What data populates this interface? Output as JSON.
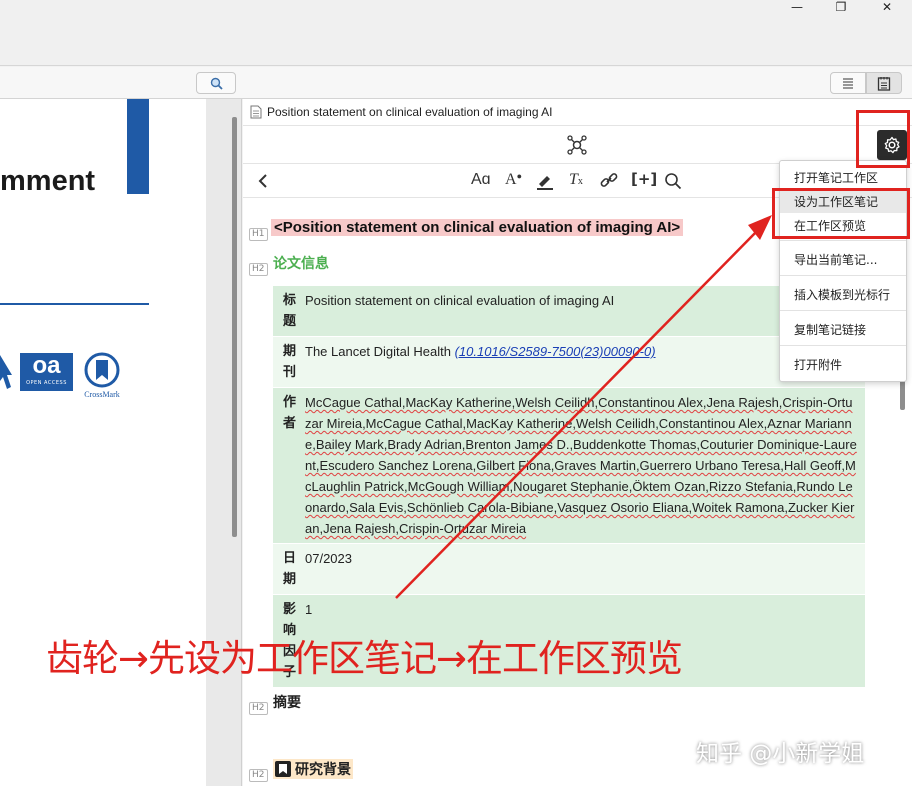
{
  "window": {
    "minimize": "—",
    "maximize": "❐",
    "close": "✕"
  },
  "pdf": {
    "heading_fragment": "mment",
    "oa_label": "oa",
    "oa_sub": "OPEN ACCESS",
    "crossmark_label": "CrossMark"
  },
  "note": {
    "doc_title": "Position statement on clinical evaluation of imaging AI",
    "h1_badge": "H1",
    "h1_text": "<Position statement on clinical evaluation of imaging AI>",
    "h2_badge": "H2",
    "section_info": "论文信息",
    "table": [
      {
        "key": "标题",
        "value": "Position statement on clinical evaluation of imaging AI"
      },
      {
        "key": "期刊",
        "value": "The Lancet Digital Health ",
        "link": "(10.1016/S2589-7500(23)00090-0)"
      },
      {
        "key": "作者",
        "value": "McCague Cathal,MacKay Katherine,Welsh Ceilidh,Constantinou Alex,Jena Rajesh,Crispin-Ortuzar Mireia,McCague Cathal,MacKay Katherine,Welsh Ceilidh,Constantinou Alex,Aznar Marianne,Bailey Mark,Brady Adrian,Brenton James D.,Buddenkotte Thomas,Couturier Dominique-Laurent,Escudero Sanchez Lorena,Gilbert Fiona,Graves Martin,Guerrero Urbano Teresa,Hall Geoff,McLaughlin Patrick,McGough William,Nougaret Stephanie,Öktem Ozan,Rizzo Stefania,Rundo Leonardo,Sala Evis,Schönlieb Carola-Bibiane,Vasquez Osorio Eliana,Woitek Ramona,Zucker Kieran,Jena Rajesh,Crispin-Ortuzar Mireia"
      },
      {
        "key": "日期",
        "value": "07/2023"
      },
      {
        "key": "影响因子",
        "value": "1"
      }
    ],
    "section_abstract": "摘要",
    "section_background": "研究背景"
  },
  "menu": {
    "items": [
      "打开笔记工作区",
      "设为工作区笔记",
      "在工作区预览",
      "导出当前笔记...",
      "插入模板到光标行",
      "复制笔记链接",
      "打开附件"
    ]
  },
  "annotation": {
    "text": "齿轮→先设为工作区笔记→在工作区预览",
    "watermark": "知乎 @小新学姐"
  },
  "colors": {
    "accent_red": "#e0231f",
    "table_green": "#d9eedc",
    "h1_highlight": "#f7c9c9",
    "section_green": "#4caf50",
    "brand_blue": "#1f5aa6"
  }
}
